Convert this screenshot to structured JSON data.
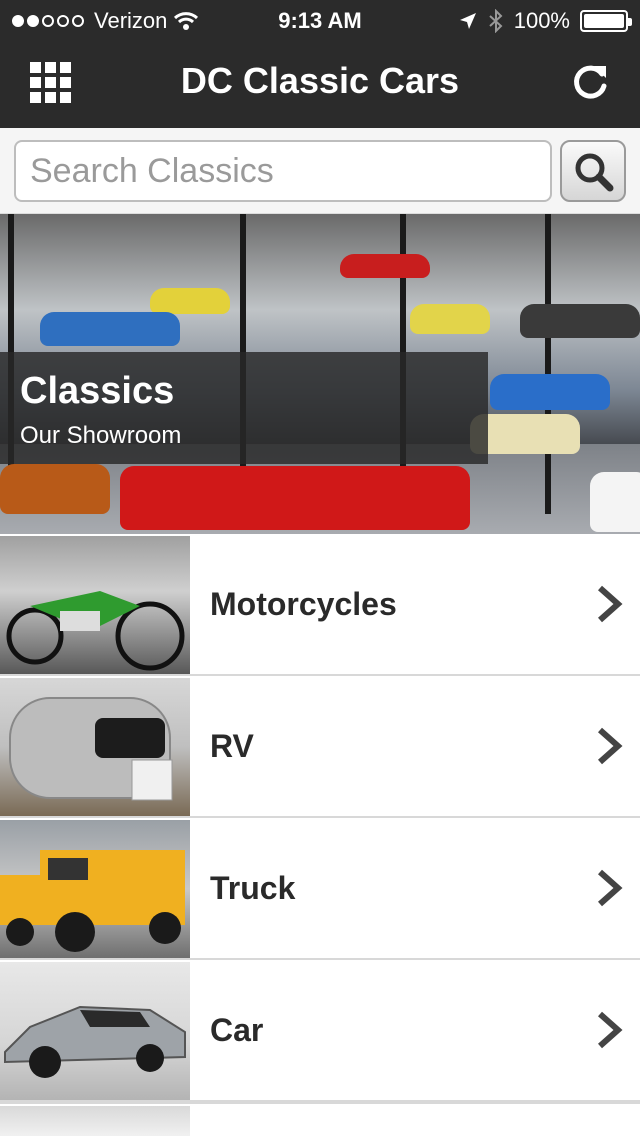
{
  "status_bar": {
    "carrier": "Verizon",
    "time": "9:13 AM",
    "battery": "100%",
    "signal_bars": 2
  },
  "nav": {
    "title": "DC Classic Cars",
    "menu_icon": "grid-icon",
    "refresh_icon": "refresh-icon"
  },
  "search": {
    "placeholder": "Search Classics",
    "value": "",
    "button_icon": "search-icon"
  },
  "hero": {
    "title": "Classics",
    "subtitle": "Our Showroom"
  },
  "categories": [
    {
      "label": "Motorcycles"
    },
    {
      "label": "RV"
    },
    {
      "label": "Truck"
    },
    {
      "label": "Car"
    }
  ],
  "colors": {
    "header_bg": "#2b2b2b",
    "accent": "#ffffff"
  }
}
